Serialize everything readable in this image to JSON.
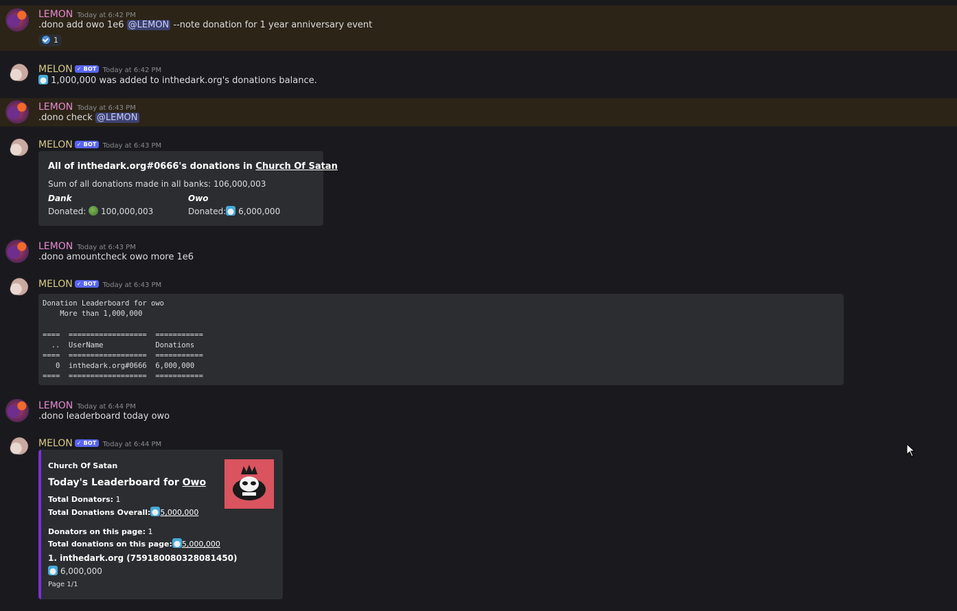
{
  "messages": [
    {
      "author": "LEMON",
      "timestamp": "Today at 6:42 PM",
      "text_parts": [
        ".dono add owo 1e6 ",
        "@LEMON",
        " --note donation for 1 year anniversary event"
      ],
      "reaction": {
        "icon": "check-circle-icon",
        "count": "1"
      }
    },
    {
      "author": "MELON",
      "bot_tag": "✓ BOT",
      "timestamp": "Today at 6:42 PM",
      "text": "1,000,000 was added to inthedark.org's donations balance."
    },
    {
      "author": "LEMON",
      "timestamp": "Today at 6:43 PM",
      "text_parts": [
        ".dono check ",
        "@LEMON"
      ]
    },
    {
      "author": "MELON",
      "bot_tag": "✓ BOT",
      "timestamp": "Today at 6:43 PM",
      "embed": {
        "title_prefix": "All of inthedark.org#0666's donations in ",
        "title_link": "Church Of Satan",
        "sum_line": "Sum of all donations made in all banks: 106,000,003",
        "fields": [
          {
            "name": "Dank",
            "label": "Donated:",
            "value": "100,000,003"
          },
          {
            "name": "Owo",
            "label": "Donated:",
            "value": "6,000,000"
          }
        ]
      }
    },
    {
      "author": "LEMON",
      "timestamp": "Today at 6:43 PM",
      "text": ".dono amountcheck owo more 1e6"
    },
    {
      "author": "MELON",
      "bot_tag": "✓ BOT",
      "timestamp": "Today at 6:43 PM",
      "code": "Donation Leaderboard for owo\n    More than 1,000,000\n\n====  ==================  ===========\n  ..  UserName            Donations\n====  ==================  ===========\n   0  inthedark.org#0666  6,000,000\n====  ==================  ==========="
    },
    {
      "author": "LEMON",
      "timestamp": "Today at 6:44 PM",
      "text": ".dono leaderboard today owo"
    },
    {
      "author": "MELON",
      "bot_tag": "✓ BOT",
      "timestamp": "Today at 6:44 PM",
      "embed": {
        "author": "Church Of Satan",
        "title_prefix": "Today's Leaderboard for ",
        "title_link": "Owo",
        "total_donators_label": "Total Donators:",
        "total_donators": "1",
        "total_overall_label": "Total Donations Overall:",
        "total_overall": "5,000,000",
        "page_donators_label": "Donators on this page:",
        "page_donators": "1",
        "page_total_label": "Total donations on this page:",
        "page_total": "5,000,000",
        "entry_title": "1. inthedark.org (759180080328081450)",
        "entry_value": "6,000,000",
        "footer": "Page 1/1"
      }
    }
  ],
  "colors": {
    "lemon": "#e58ad1",
    "melon": "#d8c98a",
    "highlight": "#2c2417",
    "embed_accent": "#7b2fd6"
  }
}
